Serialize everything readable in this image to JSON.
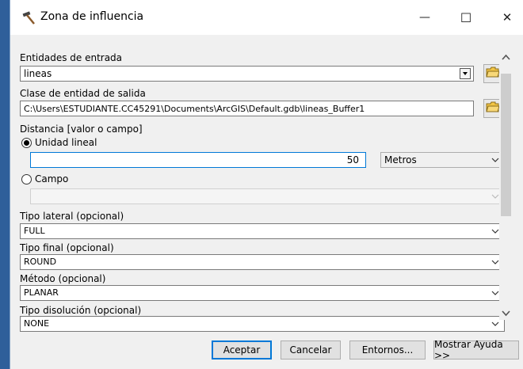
{
  "window": {
    "title": "Zona de influencia",
    "minimize_glyph": "—",
    "maximize_glyph": "☐",
    "close_glyph": "✕"
  },
  "form": {
    "input_features": {
      "label": "Entidades de entrada",
      "value": "lineas"
    },
    "output_feature_class": {
      "label": "Clase de entidad de salida",
      "value": "C:\\Users\\ESTUDIANTE.CC45291\\Documents\\ArcGIS\\Default.gdb\\lineas_Buffer1"
    },
    "distance": {
      "label": "Distancia [valor o campo]",
      "linear_unit_option": "Unidad lineal",
      "linear_unit_selected": true,
      "value": "50",
      "unit": "Metros",
      "field_option": "Campo",
      "field_value": ""
    },
    "side_type": {
      "label": "Tipo lateral (opcional)",
      "value": "FULL"
    },
    "end_type": {
      "label": "Tipo final (opcional)",
      "value": "ROUND"
    },
    "method": {
      "label": "Método (opcional)",
      "value": "PLANAR"
    },
    "dissolve_type": {
      "label": "Tipo disolución (opcional)",
      "value": "NONE"
    }
  },
  "buttons": {
    "ok": "Aceptar",
    "cancel": "Cancelar",
    "environments": "Entornos...",
    "show_help": "Mostrar Ayuda >>"
  },
  "colors": {
    "accent": "#0078d7",
    "left_strip": "#2f5f9a",
    "dialog_bg": "#f0f0f0"
  }
}
